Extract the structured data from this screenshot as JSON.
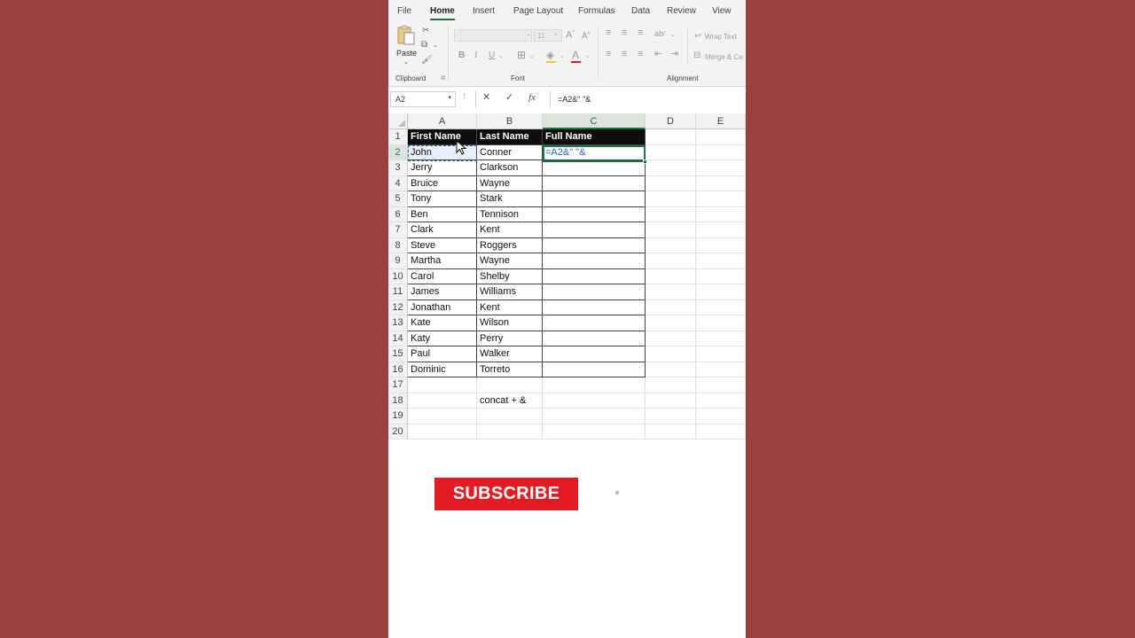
{
  "ribbon_tabs": [
    "File",
    "Home",
    "Insert",
    "Page Layout",
    "Formulas",
    "Data",
    "Review",
    "View"
  ],
  "active_tab": "Home",
  "ribbon": {
    "paste_label": "Paste",
    "clipboard_label": "Clipboard",
    "font_label": "Font",
    "font_size": "11",
    "alignment_label": "Alignment",
    "wrap_text": "Wrap Text",
    "merge_center": "Merge & Ce"
  },
  "formula_bar": {
    "name_box": "A2",
    "formula": "=A2&\" \"&"
  },
  "columns": [
    "A",
    "B",
    "C",
    "D",
    "E"
  ],
  "rows": [
    [
      "First Name",
      "Last Name",
      "Full Name"
    ],
    [
      "John",
      "Conner",
      "=A2&\" \"&"
    ],
    [
      "Jerry",
      "Clarkson",
      ""
    ],
    [
      "Bruice",
      "Wayne",
      ""
    ],
    [
      "Tony",
      "Stark",
      ""
    ],
    [
      "Ben",
      "Tennison",
      ""
    ],
    [
      "Clark",
      "Kent",
      ""
    ],
    [
      "Steve",
      "Roggers",
      ""
    ],
    [
      "Martha",
      "Wayne",
      ""
    ],
    [
      "Carol",
      "Shelby",
      ""
    ],
    [
      "James",
      "Williams",
      ""
    ],
    [
      "Jonathan",
      "Kent",
      ""
    ],
    [
      "Kate",
      "Wilson",
      ""
    ],
    [
      "Katy",
      "Perry",
      ""
    ],
    [
      "Paul",
      "Walker",
      ""
    ],
    [
      "Dominic",
      "Torreto",
      ""
    ],
    [
      "",
      "",
      ""
    ],
    [
      "",
      "concat + &",
      ""
    ],
    [
      "",
      "",
      ""
    ],
    [
      "",
      "",
      ""
    ]
  ],
  "subscribe_label": "SUBSCRIBE",
  "colors": {
    "background": "#9b4040",
    "excel_green": "#217346",
    "header_fill": "#0d0d0d",
    "subscribe_red": "#e31b23"
  }
}
